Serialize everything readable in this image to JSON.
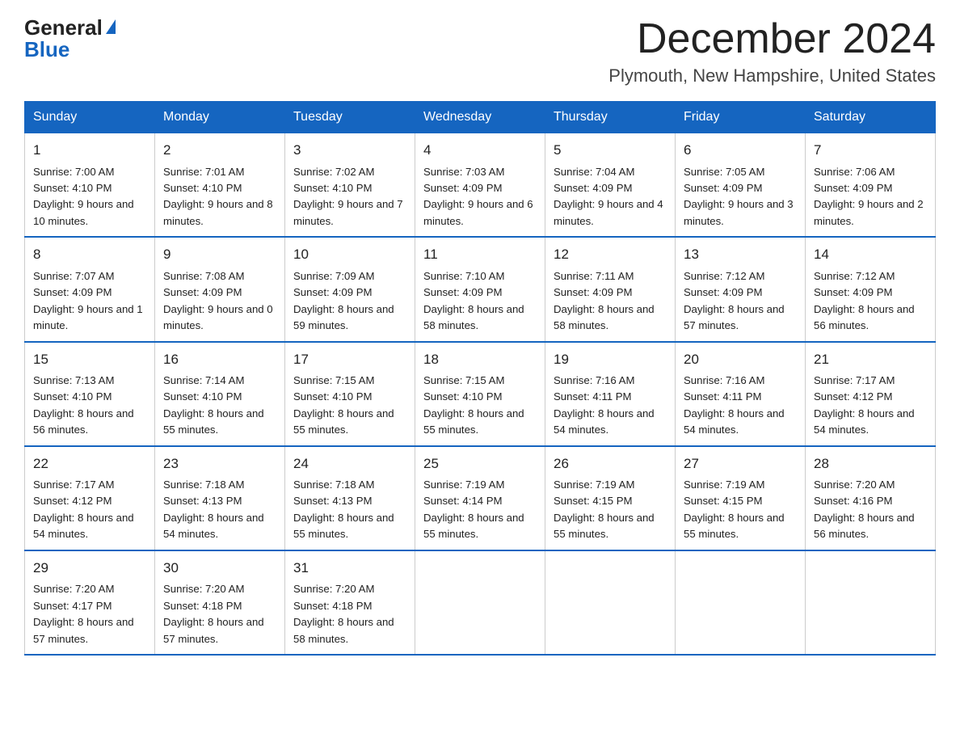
{
  "logo": {
    "general": "General",
    "blue": "Blue"
  },
  "title": "December 2024",
  "location": "Plymouth, New Hampshire, United States",
  "days_of_week": [
    "Sunday",
    "Monday",
    "Tuesday",
    "Wednesday",
    "Thursday",
    "Friday",
    "Saturday"
  ],
  "weeks": [
    [
      {
        "day": "1",
        "sunrise": "7:00 AM",
        "sunset": "4:10 PM",
        "daylight": "9 hours and 10 minutes."
      },
      {
        "day": "2",
        "sunrise": "7:01 AM",
        "sunset": "4:10 PM",
        "daylight": "9 hours and 8 minutes."
      },
      {
        "day": "3",
        "sunrise": "7:02 AM",
        "sunset": "4:10 PM",
        "daylight": "9 hours and 7 minutes."
      },
      {
        "day": "4",
        "sunrise": "7:03 AM",
        "sunset": "4:09 PM",
        "daylight": "9 hours and 6 minutes."
      },
      {
        "day": "5",
        "sunrise": "7:04 AM",
        "sunset": "4:09 PM",
        "daylight": "9 hours and 4 minutes."
      },
      {
        "day": "6",
        "sunrise": "7:05 AM",
        "sunset": "4:09 PM",
        "daylight": "9 hours and 3 minutes."
      },
      {
        "day": "7",
        "sunrise": "7:06 AM",
        "sunset": "4:09 PM",
        "daylight": "9 hours and 2 minutes."
      }
    ],
    [
      {
        "day": "8",
        "sunrise": "7:07 AM",
        "sunset": "4:09 PM",
        "daylight": "9 hours and 1 minute."
      },
      {
        "day": "9",
        "sunrise": "7:08 AM",
        "sunset": "4:09 PM",
        "daylight": "9 hours and 0 minutes."
      },
      {
        "day": "10",
        "sunrise": "7:09 AM",
        "sunset": "4:09 PM",
        "daylight": "8 hours and 59 minutes."
      },
      {
        "day": "11",
        "sunrise": "7:10 AM",
        "sunset": "4:09 PM",
        "daylight": "8 hours and 58 minutes."
      },
      {
        "day": "12",
        "sunrise": "7:11 AM",
        "sunset": "4:09 PM",
        "daylight": "8 hours and 58 minutes."
      },
      {
        "day": "13",
        "sunrise": "7:12 AM",
        "sunset": "4:09 PM",
        "daylight": "8 hours and 57 minutes."
      },
      {
        "day": "14",
        "sunrise": "7:12 AM",
        "sunset": "4:09 PM",
        "daylight": "8 hours and 56 minutes."
      }
    ],
    [
      {
        "day": "15",
        "sunrise": "7:13 AM",
        "sunset": "4:10 PM",
        "daylight": "8 hours and 56 minutes."
      },
      {
        "day": "16",
        "sunrise": "7:14 AM",
        "sunset": "4:10 PM",
        "daylight": "8 hours and 55 minutes."
      },
      {
        "day": "17",
        "sunrise": "7:15 AM",
        "sunset": "4:10 PM",
        "daylight": "8 hours and 55 minutes."
      },
      {
        "day": "18",
        "sunrise": "7:15 AM",
        "sunset": "4:10 PM",
        "daylight": "8 hours and 55 minutes."
      },
      {
        "day": "19",
        "sunrise": "7:16 AM",
        "sunset": "4:11 PM",
        "daylight": "8 hours and 54 minutes."
      },
      {
        "day": "20",
        "sunrise": "7:16 AM",
        "sunset": "4:11 PM",
        "daylight": "8 hours and 54 minutes."
      },
      {
        "day": "21",
        "sunrise": "7:17 AM",
        "sunset": "4:12 PM",
        "daylight": "8 hours and 54 minutes."
      }
    ],
    [
      {
        "day": "22",
        "sunrise": "7:17 AM",
        "sunset": "4:12 PM",
        "daylight": "8 hours and 54 minutes."
      },
      {
        "day": "23",
        "sunrise": "7:18 AM",
        "sunset": "4:13 PM",
        "daylight": "8 hours and 54 minutes."
      },
      {
        "day": "24",
        "sunrise": "7:18 AM",
        "sunset": "4:13 PM",
        "daylight": "8 hours and 55 minutes."
      },
      {
        "day": "25",
        "sunrise": "7:19 AM",
        "sunset": "4:14 PM",
        "daylight": "8 hours and 55 minutes."
      },
      {
        "day": "26",
        "sunrise": "7:19 AM",
        "sunset": "4:15 PM",
        "daylight": "8 hours and 55 minutes."
      },
      {
        "day": "27",
        "sunrise": "7:19 AM",
        "sunset": "4:15 PM",
        "daylight": "8 hours and 55 minutes."
      },
      {
        "day": "28",
        "sunrise": "7:20 AM",
        "sunset": "4:16 PM",
        "daylight": "8 hours and 56 minutes."
      }
    ],
    [
      {
        "day": "29",
        "sunrise": "7:20 AM",
        "sunset": "4:17 PM",
        "daylight": "8 hours and 57 minutes."
      },
      {
        "day": "30",
        "sunrise": "7:20 AM",
        "sunset": "4:18 PM",
        "daylight": "8 hours and 57 minutes."
      },
      {
        "day": "31",
        "sunrise": "7:20 AM",
        "sunset": "4:18 PM",
        "daylight": "8 hours and 58 minutes."
      },
      null,
      null,
      null,
      null
    ]
  ],
  "labels": {
    "sunrise": "Sunrise:",
    "sunset": "Sunset:",
    "daylight": "Daylight:"
  }
}
